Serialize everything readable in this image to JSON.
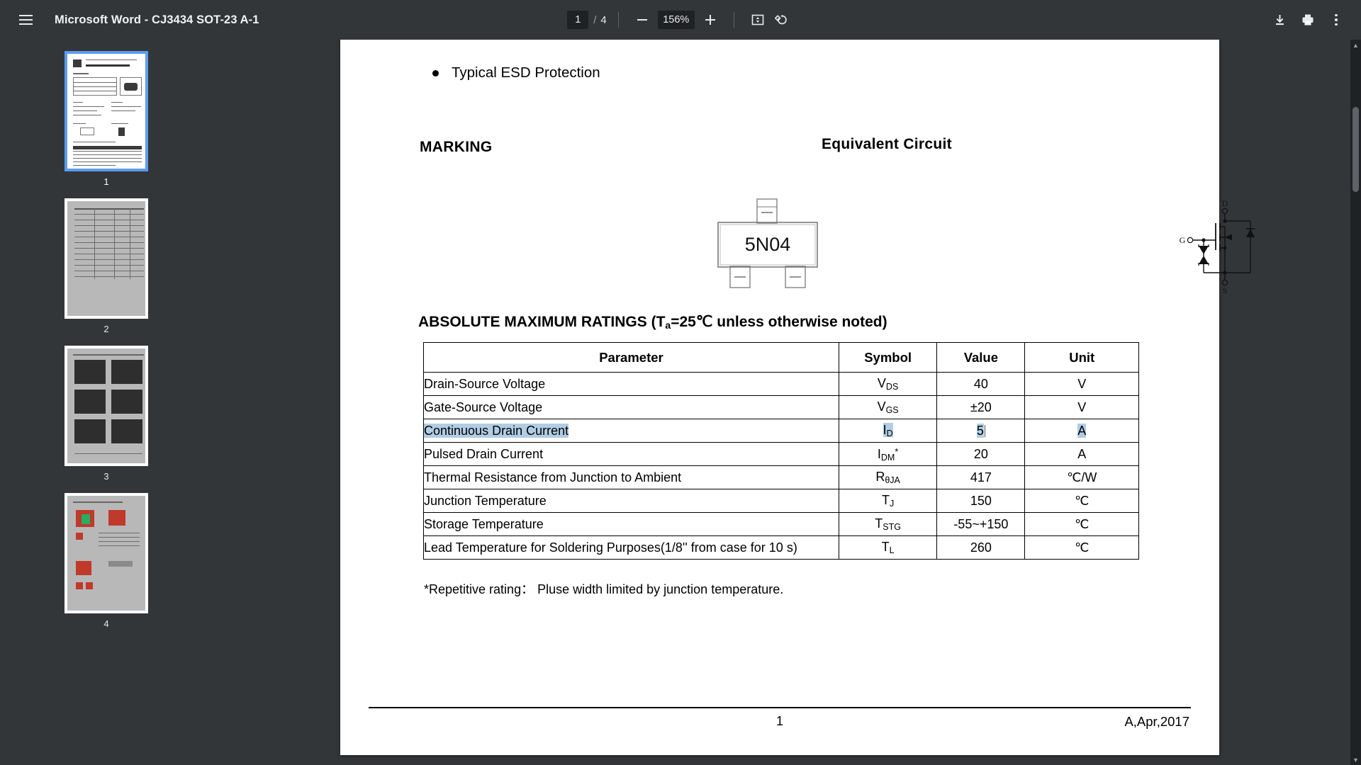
{
  "toolbar": {
    "menu_icon": "hamburger-menu-icon",
    "title": "Microsoft Word - CJ3434 SOT-23 A-1",
    "page_current": "1",
    "page_separator": "/",
    "page_total": "4",
    "zoom_out_icon": "minus-icon",
    "zoom_level": "156%",
    "zoom_in_icon": "plus-icon",
    "fit_icon": "fit-page-icon",
    "rotate_icon": "rotate-counterclockwise-icon",
    "download_icon": "download-icon",
    "print_icon": "print-icon",
    "more_icon": "more-vertical-icon"
  },
  "sidebar": {
    "thumbnails": [
      {
        "label": "1",
        "selected": true
      },
      {
        "label": "2",
        "selected": false
      },
      {
        "label": "3",
        "selected": false
      },
      {
        "label": "4",
        "selected": false
      }
    ]
  },
  "document": {
    "bullet": "Typical ESD Protection",
    "marking_heading": "MARKING",
    "equivalent_heading": "Equivalent  Circuit",
    "package_marking": "5N04",
    "circuit_labels": {
      "drain": "D",
      "gate": "G",
      "source": "S"
    },
    "ratings_heading_pre": "ABSOLUTE MAXIMUM RATINGS (T",
    "ratings_heading_sub": "a",
    "ratings_heading_post": "=25℃ unless otherwise noted)",
    "table": {
      "headers": [
        "Parameter",
        "Symbol",
        "Value",
        "Unit"
      ],
      "rows": [
        {
          "parameter": "Drain-Source Voltage",
          "symbol_base": "V",
          "symbol_sub": "DS",
          "symbol_sup": "",
          "value": "40",
          "unit": "V",
          "selected": false
        },
        {
          "parameter": "Gate-Source Voltage",
          "symbol_base": "V",
          "symbol_sub": "GS",
          "symbol_sup": "",
          "value": "±20",
          "unit": "V",
          "selected": false
        },
        {
          "parameter": "Continuous Drain Current",
          "symbol_base": "I",
          "symbol_sub": "D",
          "symbol_sup": "",
          "value": "5",
          "unit": "A",
          "selected": true
        },
        {
          "parameter": "Pulsed Drain Current",
          "symbol_base": "I",
          "symbol_sub": "DM",
          "symbol_sup": "*",
          "value": "20",
          "unit": "A",
          "selected": false
        },
        {
          "parameter": "Thermal Resistance from Junction to Ambient",
          "symbol_base": "R",
          "symbol_sub": "θJA",
          "symbol_sup": "",
          "value": "417",
          "unit": "℃/W",
          "selected": false
        },
        {
          "parameter": "Junction Temperature",
          "symbol_base": "T",
          "symbol_sub": "J",
          "symbol_sup": "",
          "value": "150",
          "unit": "℃",
          "selected": false
        },
        {
          "parameter": "Storage Temperature",
          "symbol_base": "T",
          "symbol_sub": "STG",
          "symbol_sup": "",
          "value": "-55~+150",
          "unit": "℃",
          "selected": false
        },
        {
          "parameter": "Lead Temperature for Soldering Purposes(1/8'' from case for 10 s)",
          "symbol_base": "T",
          "symbol_sub": "L",
          "symbol_sup": "",
          "value": "260",
          "unit": "℃",
          "selected": false
        }
      ]
    },
    "footnote": "*Repetitive rating： Pluse width limited by junction temperature.",
    "footer_page": "1",
    "footer_revision": "A,Apr,2017"
  },
  "colors": {
    "chrome_bg": "#323639",
    "selection_blue": "#b0cde4",
    "thumb_selected_border": "#5c9ded",
    "page_white": "#ffffff"
  }
}
